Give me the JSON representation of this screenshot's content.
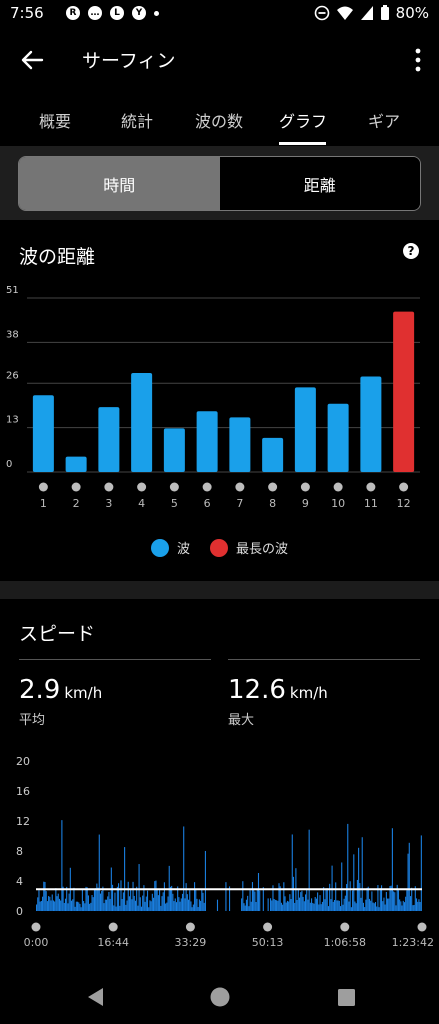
{
  "status": {
    "time": "7:56",
    "battery": "80%"
  },
  "appbar": {
    "title": "サーフィン"
  },
  "tabs": [
    {
      "label": "概要"
    },
    {
      "label": "統計"
    },
    {
      "label": "波の数"
    },
    {
      "label": "グラフ"
    },
    {
      "label": "ギア"
    }
  ],
  "segment": {
    "time_label": "時間",
    "distance_label": "距離"
  },
  "wave_distance": {
    "title": "波の距離",
    "legend": {
      "wave": "波",
      "longest": "最長の波"
    },
    "colors": {
      "wave": "#1aa0ea",
      "longest": "#e03030"
    }
  },
  "speed": {
    "title": "スピード",
    "avg_value": "2.9",
    "avg_unit": "km/h",
    "avg_label": "平均",
    "max_value": "12.6",
    "max_unit": "km/h",
    "max_label": "最大"
  },
  "chart_data": [
    {
      "type": "bar",
      "title": "波の距離",
      "categories": [
        "1",
        "2",
        "3",
        "4",
        "5",
        "6",
        "7",
        "8",
        "9",
        "10",
        "11",
        "12"
      ],
      "values": [
        22.5,
        4.5,
        19,
        29,
        12.8,
        17.8,
        16,
        10,
        24.8,
        20,
        28,
        47
      ],
      "highlight_index": 11,
      "yticks": [
        "0",
        "13",
        "26",
        "38",
        "51"
      ],
      "ylim": [
        0,
        51
      ]
    },
    {
      "type": "area",
      "title": "スピード",
      "xticks": [
        "0:00",
        "16:44",
        "33:29",
        "50:13",
        "1:06:58",
        "1:23:42"
      ],
      "yticks": [
        "0",
        "4",
        "8",
        "12",
        "16",
        "20"
      ],
      "ylim": [
        0,
        20
      ],
      "average": 2.9,
      "max": 12.6
    }
  ]
}
